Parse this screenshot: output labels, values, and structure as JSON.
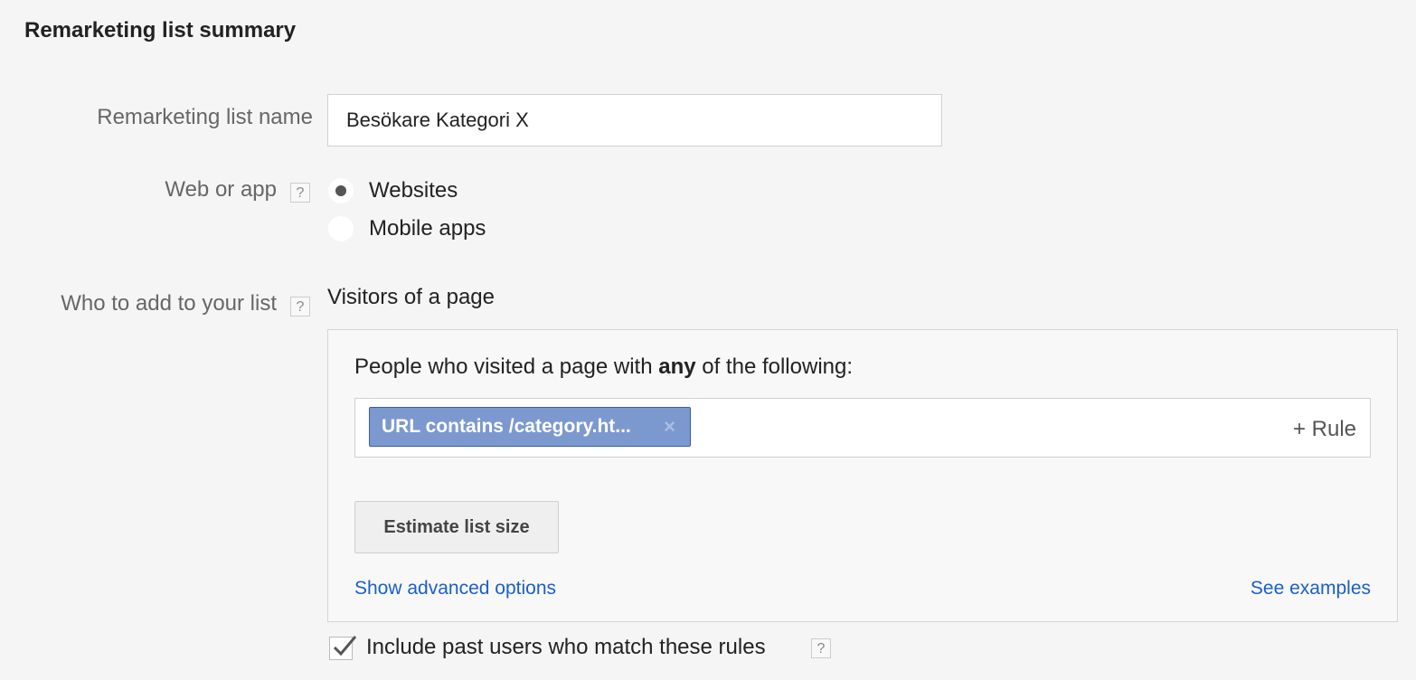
{
  "section": {
    "title": "Remarketing list summary"
  },
  "list_name": {
    "label": "Remarketing list name",
    "value": "Besökare Kategori X"
  },
  "web_or_app": {
    "label": "Web or app",
    "help": "?",
    "options": [
      {
        "label": "Websites",
        "selected": true
      },
      {
        "label": "Mobile apps",
        "selected": false
      }
    ]
  },
  "who_to_add": {
    "label": "Who to add to your list",
    "help": "?",
    "value": "Visitors of a page"
  },
  "rules_panel": {
    "intro_pre": "People who visited a page with ",
    "intro_bold": "any",
    "intro_post": " of the following:",
    "rule_chip": "URL contains /category.ht...",
    "chip_remove_icon": "×",
    "add_rule": "+ Rule",
    "estimate_button": "Estimate list size",
    "advanced_link": "Show advanced options",
    "examples_link": "See examples"
  },
  "past_users": {
    "checked": true,
    "label": "Include past users who match these rules",
    "help": "?"
  },
  "colors": {
    "chip_bg": "#7c99cf",
    "chip_border": "#355fa6",
    "link": "#1a5fc9",
    "background": "#f5f5f5"
  },
  "icons": [
    "help-icon",
    "radio-selected-icon",
    "radio-empty-icon",
    "remove-x-icon",
    "checkmark-icon"
  ]
}
